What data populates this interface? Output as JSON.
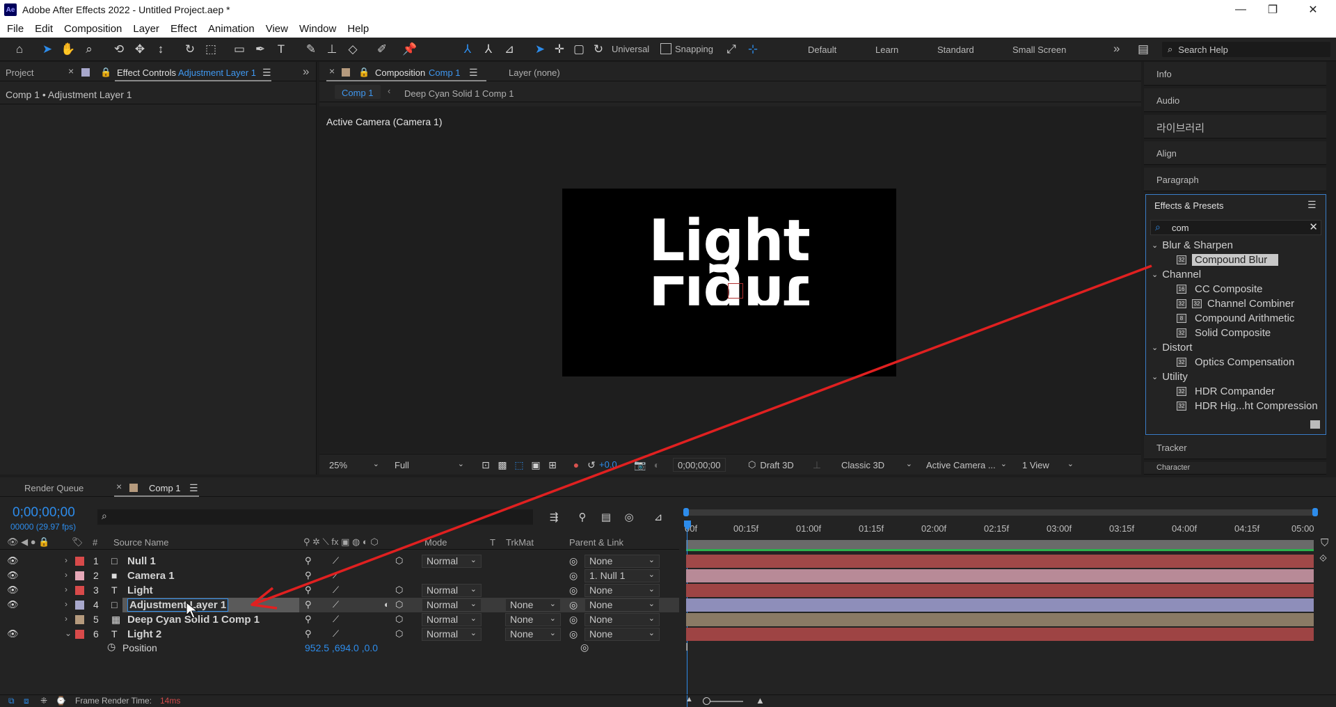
{
  "window": {
    "title": "Adobe After Effects 2022 - Untitled Project.aep *",
    "logo_text": "Ae",
    "controls": [
      "—",
      "❐",
      "✕"
    ]
  },
  "menu": [
    "File",
    "Edit",
    "Composition",
    "Layer",
    "Effect",
    "Animation",
    "View",
    "Window",
    "Help"
  ],
  "toolbar": {
    "universal_label": "Universal",
    "snapping_label": "Snapping",
    "workspaces": [
      "Default",
      "Learn",
      "Standard",
      "Small Screen"
    ],
    "more": "»",
    "search_help_placeholder": "Search Help"
  },
  "left_panel": {
    "project_tab": "Project",
    "effect_controls_tab": "Effect Controls",
    "effect_controls_layer": "Adjustment Layer 1",
    "breadcrumb": "Comp 1 • Adjustment Layer 1",
    "more": "»"
  },
  "comp_panel": {
    "composition_tab": "Composition",
    "composition_name": "Comp 1",
    "layer_tab": "Layer (none)",
    "subtabs": [
      "Comp 1",
      "Deep Cyan Solid 1 Comp 1"
    ],
    "view_label": "Active Camera (Camera 1)",
    "canvas_text": "Light",
    "canvas_text_reflected": "Light",
    "bottom": {
      "zoom": "25%",
      "resolution": "Full",
      "exposure": "+0.0",
      "timecode": "0;00;00;00",
      "draft3d": "Draft 3D",
      "renderer": "Classic 3D",
      "camera": "Active Camera ...",
      "views": "1 View"
    }
  },
  "right_panel": {
    "items": [
      "Info",
      "Audio",
      "라이브러리",
      "Align",
      "Paragraph"
    ],
    "effects_title": "Effects & Presets",
    "search_value": "com",
    "tree": [
      {
        "type": "category",
        "label": "Blur & Sharpen"
      },
      {
        "type": "effect",
        "label": "Compound Blur",
        "highlight": true
      },
      {
        "type": "category",
        "label": "Channel"
      },
      {
        "type": "effect",
        "label": "CC Composite"
      },
      {
        "type": "effect",
        "label": "Channel Combiner"
      },
      {
        "type": "effect",
        "label": "Compound Arithmetic"
      },
      {
        "type": "effect",
        "label": "Solid Composite"
      },
      {
        "type": "category",
        "label": "Distort"
      },
      {
        "type": "effect",
        "label": "Optics Compensation"
      },
      {
        "type": "category",
        "label": "Utility"
      },
      {
        "type": "effect",
        "label": "HDR Compander"
      },
      {
        "type": "effect",
        "label": "HDR Hig...ht Compression"
      }
    ],
    "tracker": "Tracker",
    "character": "Character"
  },
  "timeline": {
    "render_queue_tab": "Render Queue",
    "comp_tab": "Comp 1",
    "timecode": "0;00;00;00",
    "frame_info": "00000 (29.97 fps)",
    "headers": {
      "num": "#",
      "source_name": "Source Name",
      "mode": "Mode",
      "t": "T",
      "trkmat": "TrkMat",
      "parent": "Parent & Link"
    },
    "ruler": [
      "00f",
      "00:15f",
      "01:00f",
      "01:15f",
      "02:00f",
      "02:15f",
      "03:00f",
      "03:15f",
      "04:00f",
      "04:15f",
      "05:00"
    ],
    "layers": [
      {
        "num": "1",
        "name": "Null 1",
        "color": "#d84a4a",
        "icon": "square",
        "mode": "Normal",
        "trkmat": "",
        "parent": "None",
        "bar": "#a04848",
        "eye": true
      },
      {
        "num": "2",
        "name": "Camera 1",
        "color": "#e6a8b8",
        "icon": "camera",
        "mode": "",
        "trkmat": "",
        "parent": "1. Null 1",
        "bar": "#b88a97",
        "eye": true
      },
      {
        "num": "3",
        "name": "Light",
        "color": "#d84a4a",
        "icon": "T",
        "mode": "Normal",
        "trkmat": "",
        "parent": "None",
        "bar": "#9e4444",
        "eye": true
      },
      {
        "num": "4",
        "name": "Adjustment Layer 1",
        "color": "#a8a8cc",
        "icon": "square",
        "mode": "Normal",
        "trkmat": "None",
        "parent": "None",
        "bar": "#8e8eba",
        "eye": true,
        "selected": true
      },
      {
        "num": "5",
        "name": "Deep Cyan Solid 1 Comp 1",
        "color": "#b59a7d",
        "icon": "comp",
        "mode": "Normal",
        "trkmat": "None",
        "parent": "None",
        "bar": "#8a7a65",
        "eye": false
      },
      {
        "num": "6",
        "name": "Light 2",
        "color": "#d84a4a",
        "icon": "T",
        "mode": "Normal",
        "trkmat": "None",
        "parent": "None",
        "bar": "#9e4444",
        "eye": true,
        "expanded": true
      }
    ],
    "property": {
      "name": "Position",
      "value": "952.5 ,694.0 ,0.0"
    },
    "status": {
      "label": "Frame Render Time:",
      "value": "14ms"
    }
  },
  "colors": {
    "accent_blue": "#2d8ceb",
    "annotation_arrow": "#e02020"
  }
}
